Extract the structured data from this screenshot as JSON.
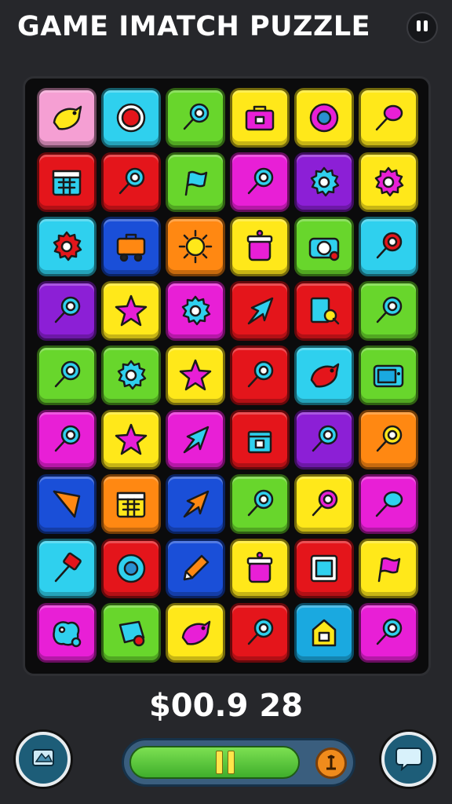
{
  "header": {
    "title": "GAME IMATCH PUZZLE",
    "menu_icon": "pause-menu-icon"
  },
  "score": {
    "text": "$00.9 28"
  },
  "progress": {
    "fill_fraction": 0.78
  },
  "colors": {
    "pink": "#f59fd3",
    "cyan": "#2fd0ee",
    "green": "#68d62c",
    "yellow": "#ffe81a",
    "red": "#e4151b",
    "purple": "#8c1fd6",
    "orange": "#ff8812",
    "magenta": "#e81fd6",
    "blue": "#1a4fd8",
    "teal": "#1aa9e0"
  },
  "board": {
    "rows": [
      [
        "pink:bird",
        "cyan:target",
        "green:pin",
        "yellow:toolbox",
        "yellow:ring",
        "yellow:balloon"
      ],
      [
        "red:calendar",
        "red:pin",
        "green:flag",
        "magenta:pin",
        "purple:gear",
        "yellow:gear"
      ],
      [
        "cyan:gear",
        "blue:cart",
        "orange:sun",
        "yellow:jar",
        "green:camera",
        "cyan:pin"
      ],
      [
        "purple:pin",
        "yellow:star",
        "magenta:gear",
        "red:arrow",
        "red:key",
        "green:pin"
      ],
      [
        "green:pin",
        "green:gear",
        "yellow:star",
        "red:pin",
        "cyan:bird",
        "green:tv"
      ],
      [
        "magenta:pin",
        "yellow:star",
        "magenta:arrow",
        "red:box",
        "purple:pin",
        "orange:pin"
      ],
      [
        "blue:kite",
        "orange:calendar",
        "blue:arrow",
        "green:pin",
        "yellow:pin",
        "magenta:balloon"
      ],
      [
        "cyan:hammer",
        "red:ring",
        "blue:pencil",
        "yellow:jar",
        "red:frame",
        "yellow:flag"
      ],
      [
        "magenta:cheese",
        "green:bag",
        "yellow:bird",
        "red:pin",
        "teal:house",
        "magenta:pin"
      ]
    ]
  }
}
